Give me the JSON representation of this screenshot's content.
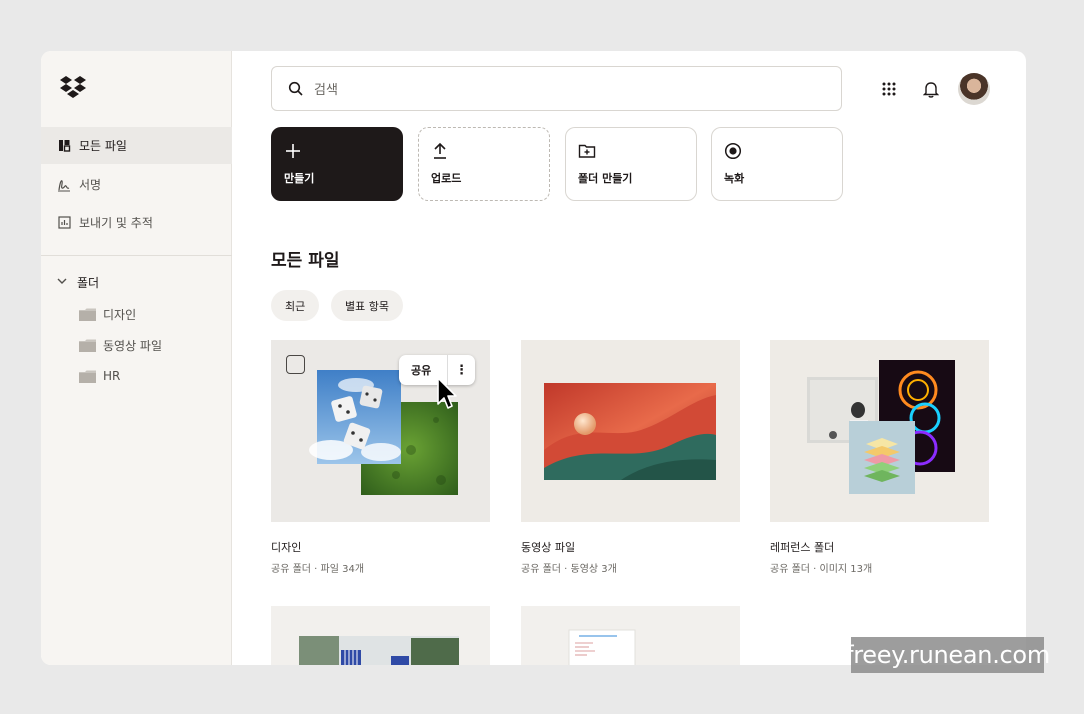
{
  "sidebar": {
    "items": [
      {
        "label": "모든 파일",
        "icon": "files-icon",
        "active": true
      },
      {
        "label": "서명",
        "icon": "signature-icon",
        "active": false
      },
      {
        "label": "보내기 및 추적",
        "icon": "chart-icon",
        "active": false
      }
    ],
    "folders_label": "폴더",
    "folders": [
      {
        "label": "디자인"
      },
      {
        "label": "동영상 파일"
      },
      {
        "label": "HR"
      }
    ]
  },
  "search": {
    "placeholder": "검색"
  },
  "actions": [
    {
      "label": "만들기",
      "icon": "plus-icon"
    },
    {
      "label": "업로드",
      "icon": "upload-icon"
    },
    {
      "label": "폴더 만들기",
      "icon": "folder-plus-icon"
    },
    {
      "label": "녹화",
      "icon": "record-icon"
    }
  ],
  "main": {
    "title": "모든 파일",
    "filters": [
      "최근",
      "별표 항목"
    ]
  },
  "cards": [
    {
      "title": "디자인",
      "subtitle": "공유 폴더 · 파일 34개"
    },
    {
      "title": "동영상 파일",
      "subtitle": "공유 폴더 · 동영상 3개"
    },
    {
      "title": "레퍼런스 폴더",
      "subtitle": "공유 폴더 · 이미지 13개"
    }
  ],
  "hover": {
    "share_label": "공유",
    "more_label": "⋮"
  },
  "watermark": "freey.runean.com",
  "colors": {
    "accent_dark": "#1e1919",
    "sidebar_bg": "#f7f5f2"
  }
}
